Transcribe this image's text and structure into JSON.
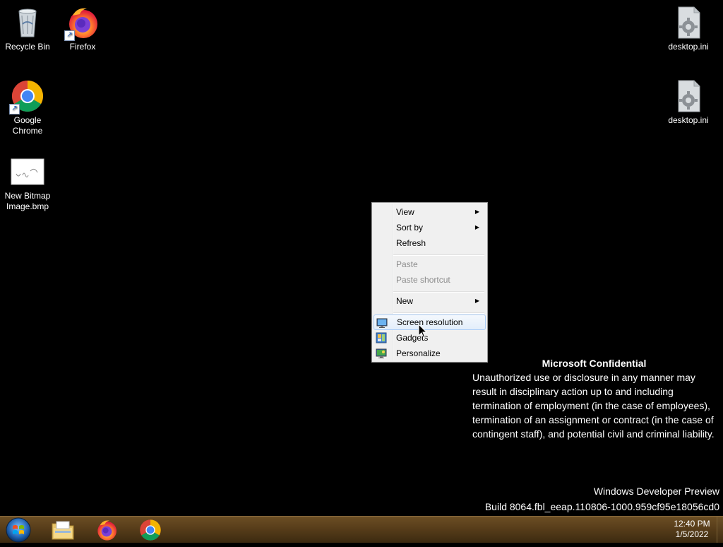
{
  "desktop": {
    "icons": [
      {
        "id": "recycle-bin",
        "label": "Recycle Bin"
      },
      {
        "id": "firefox",
        "label": "Firefox"
      },
      {
        "id": "google-chrome",
        "label": "Google Chrome"
      },
      {
        "id": "new-bitmap",
        "label": "New Bitmap Image.bmp"
      },
      {
        "id": "desktop-ini-1",
        "label": "desktop.ini"
      },
      {
        "id": "desktop-ini-2",
        "label": "desktop.ini"
      }
    ]
  },
  "context_menu": {
    "items": [
      {
        "label": "View",
        "submenu": true,
        "disabled": false
      },
      {
        "label": "Sort by",
        "submenu": true,
        "disabled": false
      },
      {
        "label": "Refresh",
        "submenu": false,
        "disabled": false
      },
      {
        "label": "Paste",
        "submenu": false,
        "disabled": true
      },
      {
        "label": "Paste shortcut",
        "submenu": false,
        "disabled": true
      },
      {
        "label": "New",
        "submenu": true,
        "disabled": false
      },
      {
        "label": "Screen resolution",
        "submenu": false,
        "disabled": false,
        "highlighted": true,
        "icon": "screen-resolution-icon"
      },
      {
        "label": "Gadgets",
        "submenu": false,
        "disabled": false,
        "icon": "gadgets-icon"
      },
      {
        "label": "Personalize",
        "submenu": false,
        "disabled": false,
        "icon": "personalize-icon"
      }
    ]
  },
  "watermark": {
    "title": "Microsoft Confidential",
    "body": "Unauthorized use or disclosure in any manner may result in disciplinary action up to and including termination of employment (in the case of employees), termination of an assignment or contract (in the case of contingent staff), and potential civil and criminal liability.",
    "edition": "Windows Developer Preview",
    "build": "Build 8064.fbl_eeap.110806-1000.959cf95e18056cd0"
  },
  "taskbar": {
    "pinned": [
      "start-orb",
      "file-explorer-icon",
      "firefox-icon",
      "chrome-icon"
    ],
    "clock": {
      "time": "12:40 PM",
      "date": "1/5/2022"
    }
  },
  "colors": {
    "taskbar": "#5a3f1b",
    "menu_background": "#f0f0f0",
    "menu_highlight_border": "#aecff7",
    "desktop_background": "#000000"
  }
}
